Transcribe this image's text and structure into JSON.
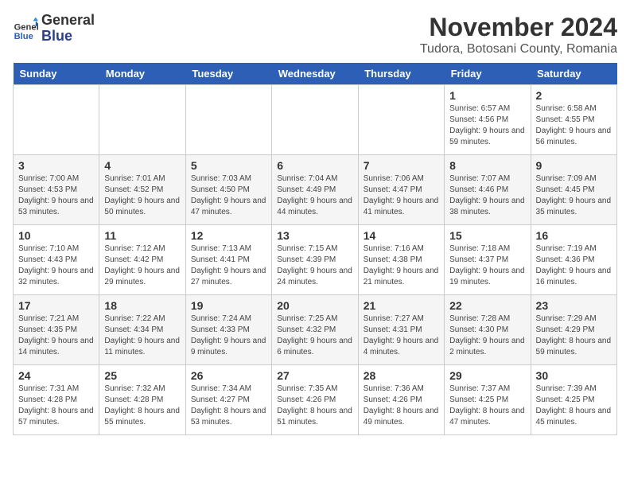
{
  "logo": {
    "line1": "General",
    "line2": "Blue"
  },
  "title": "November 2024",
  "subtitle": "Tudora, Botosani County, Romania",
  "days_of_week": [
    "Sunday",
    "Monday",
    "Tuesday",
    "Wednesday",
    "Thursday",
    "Friday",
    "Saturday"
  ],
  "weeks": [
    [
      {
        "day": "",
        "info": ""
      },
      {
        "day": "",
        "info": ""
      },
      {
        "day": "",
        "info": ""
      },
      {
        "day": "",
        "info": ""
      },
      {
        "day": "",
        "info": ""
      },
      {
        "day": "1",
        "info": "Sunrise: 6:57 AM\nSunset: 4:56 PM\nDaylight: 9 hours and 59 minutes."
      },
      {
        "day": "2",
        "info": "Sunrise: 6:58 AM\nSunset: 4:55 PM\nDaylight: 9 hours and 56 minutes."
      }
    ],
    [
      {
        "day": "3",
        "info": "Sunrise: 7:00 AM\nSunset: 4:53 PM\nDaylight: 9 hours and 53 minutes."
      },
      {
        "day": "4",
        "info": "Sunrise: 7:01 AM\nSunset: 4:52 PM\nDaylight: 9 hours and 50 minutes."
      },
      {
        "day": "5",
        "info": "Sunrise: 7:03 AM\nSunset: 4:50 PM\nDaylight: 9 hours and 47 minutes."
      },
      {
        "day": "6",
        "info": "Sunrise: 7:04 AM\nSunset: 4:49 PM\nDaylight: 9 hours and 44 minutes."
      },
      {
        "day": "7",
        "info": "Sunrise: 7:06 AM\nSunset: 4:47 PM\nDaylight: 9 hours and 41 minutes."
      },
      {
        "day": "8",
        "info": "Sunrise: 7:07 AM\nSunset: 4:46 PM\nDaylight: 9 hours and 38 minutes."
      },
      {
        "day": "9",
        "info": "Sunrise: 7:09 AM\nSunset: 4:45 PM\nDaylight: 9 hours and 35 minutes."
      }
    ],
    [
      {
        "day": "10",
        "info": "Sunrise: 7:10 AM\nSunset: 4:43 PM\nDaylight: 9 hours and 32 minutes."
      },
      {
        "day": "11",
        "info": "Sunrise: 7:12 AM\nSunset: 4:42 PM\nDaylight: 9 hours and 29 minutes."
      },
      {
        "day": "12",
        "info": "Sunrise: 7:13 AM\nSunset: 4:41 PM\nDaylight: 9 hours and 27 minutes."
      },
      {
        "day": "13",
        "info": "Sunrise: 7:15 AM\nSunset: 4:39 PM\nDaylight: 9 hours and 24 minutes."
      },
      {
        "day": "14",
        "info": "Sunrise: 7:16 AM\nSunset: 4:38 PM\nDaylight: 9 hours and 21 minutes."
      },
      {
        "day": "15",
        "info": "Sunrise: 7:18 AM\nSunset: 4:37 PM\nDaylight: 9 hours and 19 minutes."
      },
      {
        "day": "16",
        "info": "Sunrise: 7:19 AM\nSunset: 4:36 PM\nDaylight: 9 hours and 16 minutes."
      }
    ],
    [
      {
        "day": "17",
        "info": "Sunrise: 7:21 AM\nSunset: 4:35 PM\nDaylight: 9 hours and 14 minutes."
      },
      {
        "day": "18",
        "info": "Sunrise: 7:22 AM\nSunset: 4:34 PM\nDaylight: 9 hours and 11 minutes."
      },
      {
        "day": "19",
        "info": "Sunrise: 7:24 AM\nSunset: 4:33 PM\nDaylight: 9 hours and 9 minutes."
      },
      {
        "day": "20",
        "info": "Sunrise: 7:25 AM\nSunset: 4:32 PM\nDaylight: 9 hours and 6 minutes."
      },
      {
        "day": "21",
        "info": "Sunrise: 7:27 AM\nSunset: 4:31 PM\nDaylight: 9 hours and 4 minutes."
      },
      {
        "day": "22",
        "info": "Sunrise: 7:28 AM\nSunset: 4:30 PM\nDaylight: 9 hours and 2 minutes."
      },
      {
        "day": "23",
        "info": "Sunrise: 7:29 AM\nSunset: 4:29 PM\nDaylight: 8 hours and 59 minutes."
      }
    ],
    [
      {
        "day": "24",
        "info": "Sunrise: 7:31 AM\nSunset: 4:28 PM\nDaylight: 8 hours and 57 minutes."
      },
      {
        "day": "25",
        "info": "Sunrise: 7:32 AM\nSunset: 4:28 PM\nDaylight: 8 hours and 55 minutes."
      },
      {
        "day": "26",
        "info": "Sunrise: 7:34 AM\nSunset: 4:27 PM\nDaylight: 8 hours and 53 minutes."
      },
      {
        "day": "27",
        "info": "Sunrise: 7:35 AM\nSunset: 4:26 PM\nDaylight: 8 hours and 51 minutes."
      },
      {
        "day": "28",
        "info": "Sunrise: 7:36 AM\nSunset: 4:26 PM\nDaylight: 8 hours and 49 minutes."
      },
      {
        "day": "29",
        "info": "Sunrise: 7:37 AM\nSunset: 4:25 PM\nDaylight: 8 hours and 47 minutes."
      },
      {
        "day": "30",
        "info": "Sunrise: 7:39 AM\nSunset: 4:25 PM\nDaylight: 8 hours and 45 minutes."
      }
    ]
  ]
}
